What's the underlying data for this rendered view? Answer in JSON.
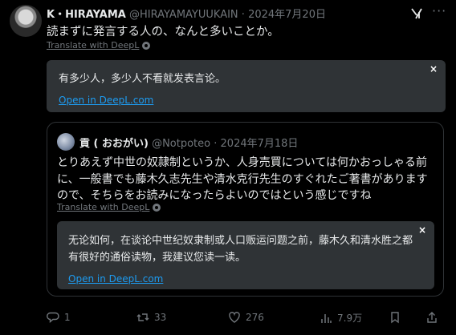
{
  "author": {
    "name": "K・HIRAYAMA",
    "handle": "@HIRAYAMAYUUKAIN",
    "separator": "·",
    "date": "2024年7月20日"
  },
  "tweet": {
    "text": "読まずに発言する人の、なんと多いことか。",
    "translate_label": "Translate with DeepL"
  },
  "translation_1": {
    "text": "有多少人，多少人不看就发表言论。",
    "open_label": "Open in DeepL.com",
    "close_label": "×"
  },
  "quote": {
    "name": "貢 ( おおがい)",
    "handle": "@Notpoteo",
    "separator": "·",
    "date": "2024年7月18日",
    "text": "とりあえず中世の奴隷制というか、人身売買については何かおっしゃる前に、一般書でも藤木久志先生や清水克行先生のすぐれたご著書がありますので、そちらをお読みになったらよいのではという感じですね",
    "translate_label": "Translate with DeepL"
  },
  "translation_2": {
    "text": "无论如何，在谈论中世纪奴隶制或人口贩运问题之前，藤木久和清水胜之都有很好的通俗读物，我建议您读一读。",
    "open_label": "Open in DeepL.com",
    "close_label": "×"
  },
  "actions": {
    "replies": "1",
    "retweets": "33",
    "likes": "276",
    "views": "7.9万"
  },
  "colors": {
    "background": "#000000",
    "text": "#e7e9ea",
    "muted": "#71767b",
    "link": "#1d9bf0",
    "panel": "#2f3336"
  }
}
